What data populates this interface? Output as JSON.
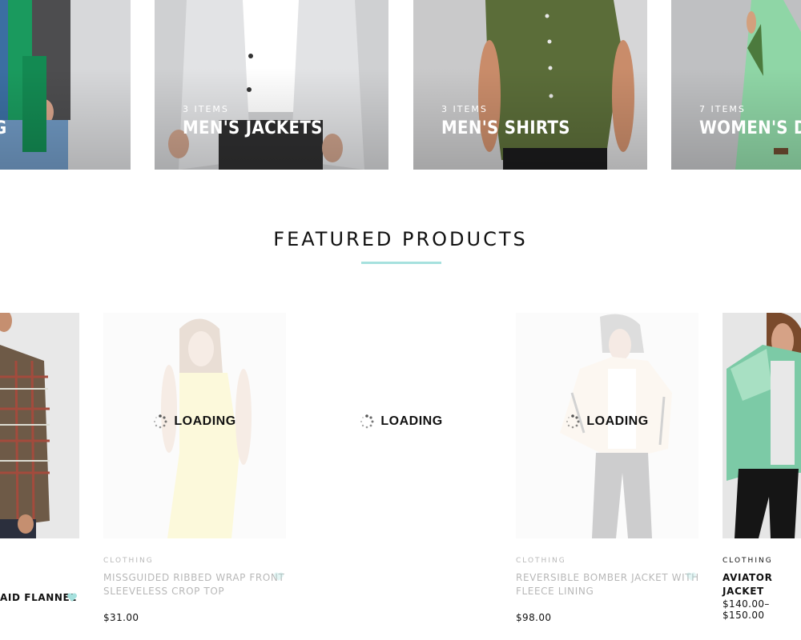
{
  "categories": [
    {
      "count": "",
      "name": "G"
    },
    {
      "count": "3 ITEMS",
      "name": "MEN'S JACKETS"
    },
    {
      "count": "3 ITEMS",
      "name": "MEN'S SHIRTS"
    },
    {
      "count": "7 ITEMS",
      "name": "WOMEN'S DR"
    }
  ],
  "section": {
    "title": "FEATURED PRODUCTS"
  },
  "loading_label": "LOADING",
  "products": [
    {
      "category": "",
      "title": "AID FLANNEL",
      "price": ""
    },
    {
      "category": "CLOTHING",
      "title_line1": "MISSGUIDED RIBBED WRAP FRONT",
      "title_line2": "SLEEVELESS CROP TOP",
      "price": "$31.00"
    },
    {
      "category": "",
      "title": "",
      "price": ""
    },
    {
      "category": "CLOTHING",
      "title_line1": "REVERSIBLE BOMBER JACKET WITH",
      "title_line2": "FLEECE LINING",
      "price": "$98.00"
    },
    {
      "category": "CLOTHING",
      "title": "AVIATOR JACKET",
      "price": "$140.00–$150.00"
    }
  ],
  "colors": {
    "accent": "#a6e1de",
    "heart": "#a6e1de"
  },
  "icons": [
    "spinner-icon",
    "heart-icon"
  ]
}
